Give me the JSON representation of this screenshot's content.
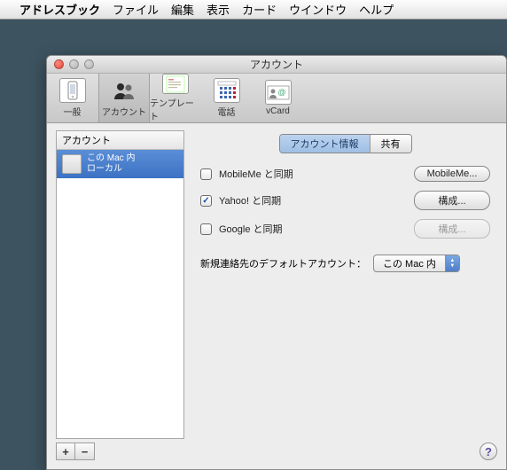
{
  "menubar": {
    "apple": "",
    "app": "アドレスブック",
    "items": [
      "ファイル",
      "編集",
      "表示",
      "カード",
      "ウインドウ",
      "ヘルプ"
    ]
  },
  "window": {
    "title": "アカウント"
  },
  "toolbar": {
    "items": [
      {
        "label": "一般"
      },
      {
        "label": "アカウント"
      },
      {
        "label": "テンプレート"
      },
      {
        "label": "電話"
      },
      {
        "label": "vCard"
      }
    ]
  },
  "sidebar": {
    "header": "アカウント",
    "account": {
      "line1": "この Mac 内",
      "line2": "ローカル"
    },
    "add": "+",
    "remove": "−"
  },
  "tabs": {
    "info": "アカウント情報",
    "share": "共有"
  },
  "sync": {
    "mobileme": {
      "label": "MobileMe と同期",
      "button": "MobileMe..."
    },
    "yahoo": {
      "label": "Yahoo! と同期",
      "button": "構成..."
    },
    "google": {
      "label": "Google と同期",
      "button": "構成..."
    }
  },
  "default_account": {
    "label": "新規連絡先のデフォルトアカウント：",
    "value": "この Mac 内"
  },
  "help": "?"
}
